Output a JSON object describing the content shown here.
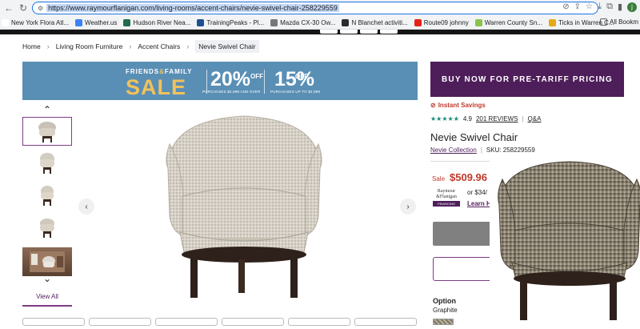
{
  "browser": {
    "url": "https://www.raymourflanigan.com/living-rooms/accent-chairs/nevie-swivel-chair-258229559",
    "bookmarks": [
      {
        "label": "New York Flora Atl...",
        "color": "#ffffff"
      },
      {
        "label": "Weather.us",
        "color": "#3b82f6"
      },
      {
        "label": "Hudson River Nea...",
        "color": "#1f6b4a"
      },
      {
        "label": "TrainingPeaks - Pl...",
        "color": "#1d4f91"
      },
      {
        "label": "Mazda CX-30 Ow...",
        "color": "#777777"
      },
      {
        "label": "N Blanchet activiti...",
        "color": "#2b2b2b"
      },
      {
        "label": "Route09 johnny",
        "color": "#e62117"
      },
      {
        "label": "Warren County Sn...",
        "color": "#8bc34a"
      },
      {
        "label": "Ticks in Warren C...",
        "color": "#e6a817"
      }
    ],
    "all_bookmarks": "All Bookm",
    "avatar": "j"
  },
  "breadcrumb": [
    "Home",
    "Living Room Furniture",
    "Accent Chairs",
    "Nevie Swivel Chair"
  ],
  "banner": {
    "friends": "FRIENDS",
    "amp": "&",
    "family": "FAMILY",
    "sale": "SALE",
    "offer1_pct": "20%",
    "offer1_off": "OFF",
    "offer1_fine": "PURCHASES $2,999 AND OVER",
    "offer2_pct": "15%",
    "offer2_off": "OFF",
    "offer2_fine": "PURCHASES UP TO $2,999"
  },
  "promo": "BUY NOW FOR PRE-TARIFF PRICING",
  "gallery": {
    "view_all": "View All"
  },
  "product": {
    "instant_savings": "Instant Savings",
    "rating": "4.9",
    "stars": "★★★★★",
    "reviews": "201 REVIEWS",
    "qa": "Q&A",
    "title": "Nevie Swivel Chair",
    "collection": "Nevie Collection",
    "sku": "SKU: 258229559",
    "sale_label": "Sale",
    "price": "$509.96",
    "financing_logo_1": "Raymour",
    "financing_logo_2": "&Flanigan",
    "financing_logo_3": "FINANCING",
    "financing_text": "or $34/",
    "learn": "Learn H",
    "option_label": "Option",
    "option_value": "Graphite"
  }
}
